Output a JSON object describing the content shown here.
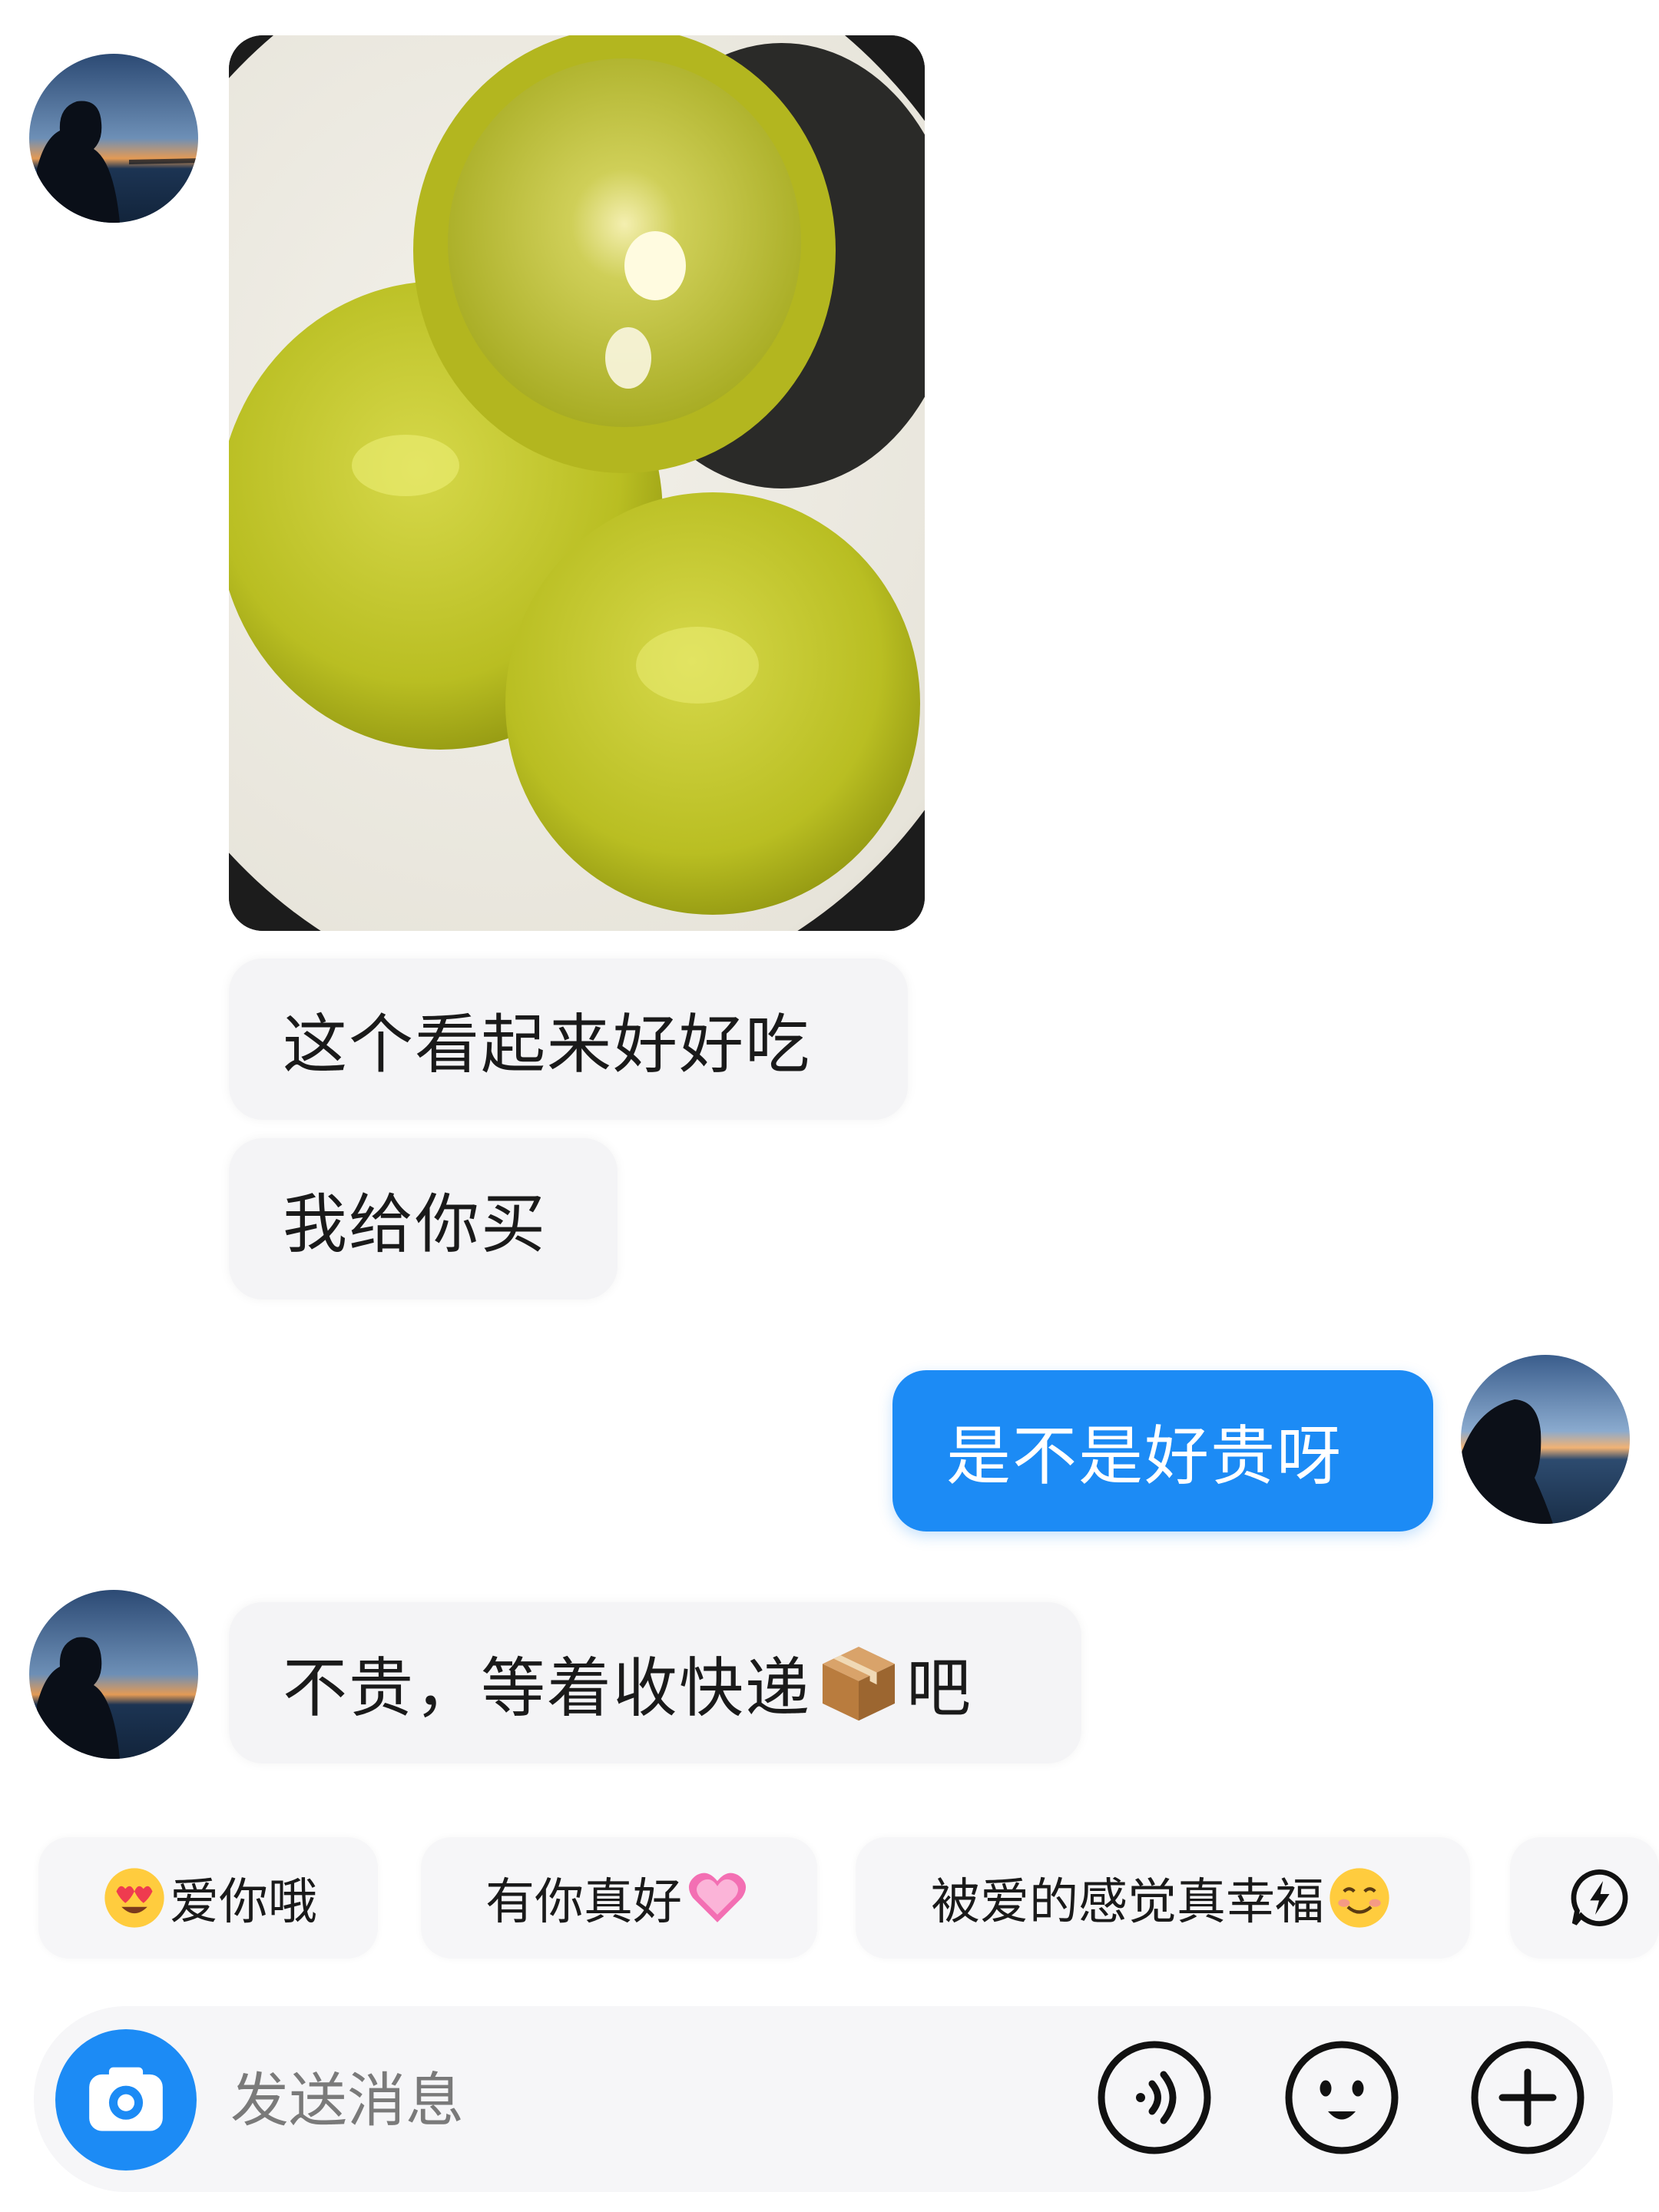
{
  "messages": [
    {
      "from": "them",
      "type": "image"
    },
    {
      "from": "them",
      "text": "这个看起来好好吃"
    },
    {
      "from": "them",
      "text": "我给你买"
    },
    {
      "from": "me",
      "text": "是不是好贵呀"
    },
    {
      "from": "them",
      "text_before": "不贵，等着收快递",
      "emoji": "package-emoji",
      "text_after": "吧"
    }
  ],
  "quick_replies": [
    {
      "text": "爱你哦",
      "emoji": "heart-eyes-emoji",
      "emoji_position": "before"
    },
    {
      "text": "有你真好",
      "emoji": "pink-heart-emoji",
      "emoji_position": "after"
    },
    {
      "text": "被爱的感觉真幸福",
      "emoji": "smiling-face-emoji",
      "emoji_position": "after"
    },
    {
      "text": "",
      "icon": "lightning-bubble-icon"
    }
  ],
  "input": {
    "placeholder": "发送消息",
    "left_icon": "camera-icon",
    "right_icons": [
      "voice-icon",
      "emoji-icon",
      "plus-icon"
    ]
  },
  "colors": {
    "my_bubble": "#1c8bf5",
    "their_bubble": "#f4f4f6",
    "accent": "#1c8bf5"
  }
}
